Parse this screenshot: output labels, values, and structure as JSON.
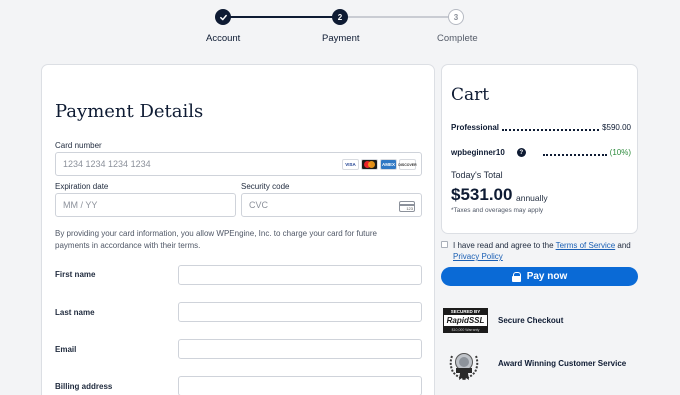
{
  "stepper": {
    "steps": [
      {
        "label": "Account",
        "status": "done"
      },
      {
        "label": "Payment",
        "number": "2",
        "status": "current"
      },
      {
        "label": "Complete",
        "number": "3",
        "status": "todo"
      }
    ]
  },
  "payment": {
    "title": "Payment Details",
    "card_number_label": "Card number",
    "card_number_placeholder": "1234 1234 1234 1234",
    "card_brands": [
      "VISA",
      "mastercard",
      "AMEX",
      "DISCOVER"
    ],
    "expiration_label": "Expiration date",
    "expiration_placeholder": "MM / YY",
    "security_label": "Security code",
    "security_placeholder": "CVC",
    "cvc_icon_text": "123",
    "consent_text": "By providing your card information, you allow WPEngine, Inc. to charge your card for future payments in accordance with their terms.",
    "first_name_label": "First name",
    "last_name_label": "Last name",
    "email_label": "Email",
    "billing_label": "Billing address"
  },
  "cart": {
    "title": "Cart",
    "items": [
      {
        "name": "Professional",
        "amount": "$590.00"
      },
      {
        "name": "wpbeginner10",
        "amount": "(10%)"
      }
    ],
    "today_label": "Today's Total",
    "total": "$531.00",
    "total_suffix": "annually",
    "tax_note": "*Taxes and overages may apply"
  },
  "agree": {
    "prefix": "I have read and agree to the ",
    "tos": "Terms of Service",
    "and": " and ",
    "privacy": "Privacy Policy"
  },
  "pay_button": "Pay now",
  "trust": {
    "ssl_top": "SECURED BY",
    "ssl_mid": "RapidSSL",
    "ssl_bot": "$10,000 Warranty",
    "secure_checkout": "Secure Checkout",
    "award_text": "Award Winning Customer Service"
  },
  "colors": {
    "navy": "#0e1b33",
    "accent": "#0a6ad6",
    "discount_green": "#2e8b3d"
  }
}
